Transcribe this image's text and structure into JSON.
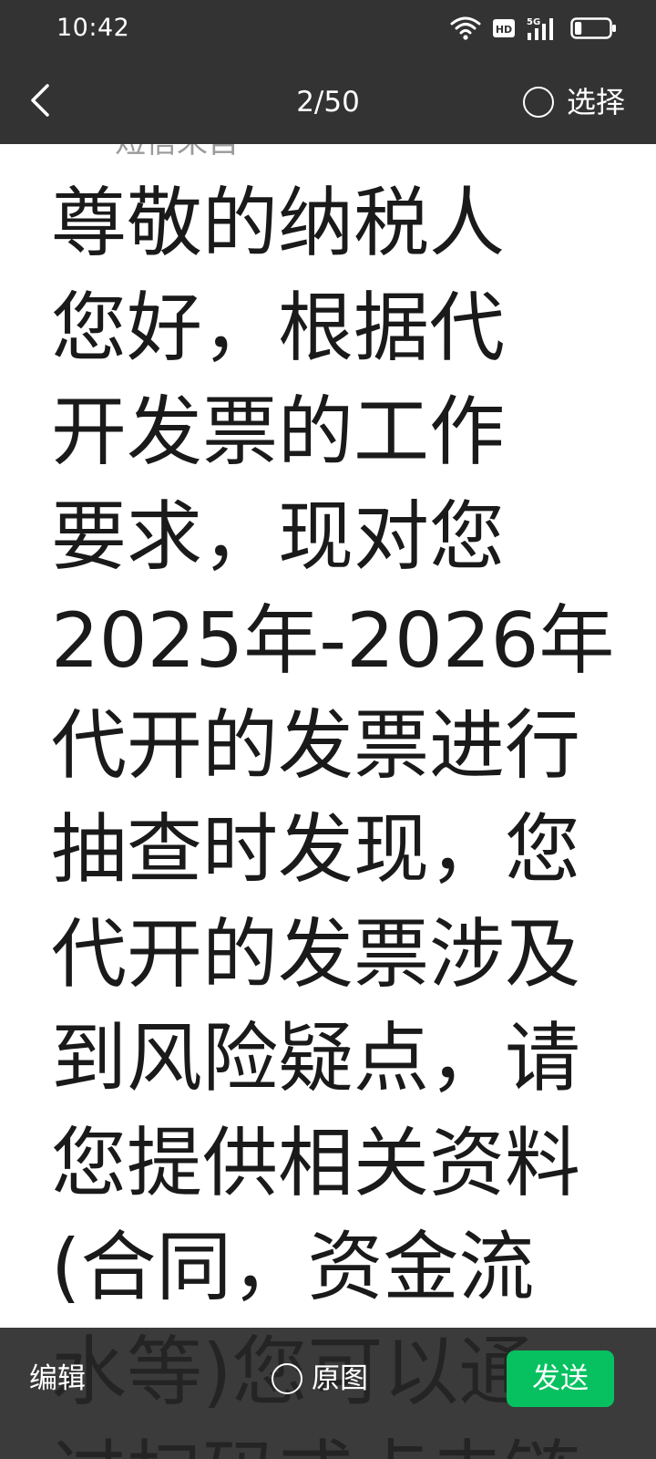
{
  "status_bar": {
    "time": "10:42",
    "icons": [
      "wifi-icon",
      "hd-icon",
      "signal-5g-icon",
      "battery-icon"
    ],
    "hd_label": "HD",
    "network_label": "5G",
    "battery_level": 0.2
  },
  "nav": {
    "back_icon": "chevron-left-icon",
    "page_counter": "2/50",
    "select_label": "选择"
  },
  "preview": {
    "cropped_line": "短信来自",
    "message_lines": [
      "尊敬的纳税人",
      "您好，根据代",
      "开发票的工作",
      "要求，现对您",
      "2025年-2026年",
      "代开的发票进行",
      "抽查时发现，您",
      "代开的发票涉及",
      "到风险疑点，请",
      "您提供相关资料",
      "(合同，资金流",
      "水等)您可以通",
      "过扫码或点击链"
    ]
  },
  "bottom_bar": {
    "edit_label": "编辑",
    "original_label": "原图",
    "send_label": "发送"
  },
  "colors": {
    "bar_background": "#333333",
    "send_green": "#07c160",
    "text_dark": "#1a1a1a"
  }
}
